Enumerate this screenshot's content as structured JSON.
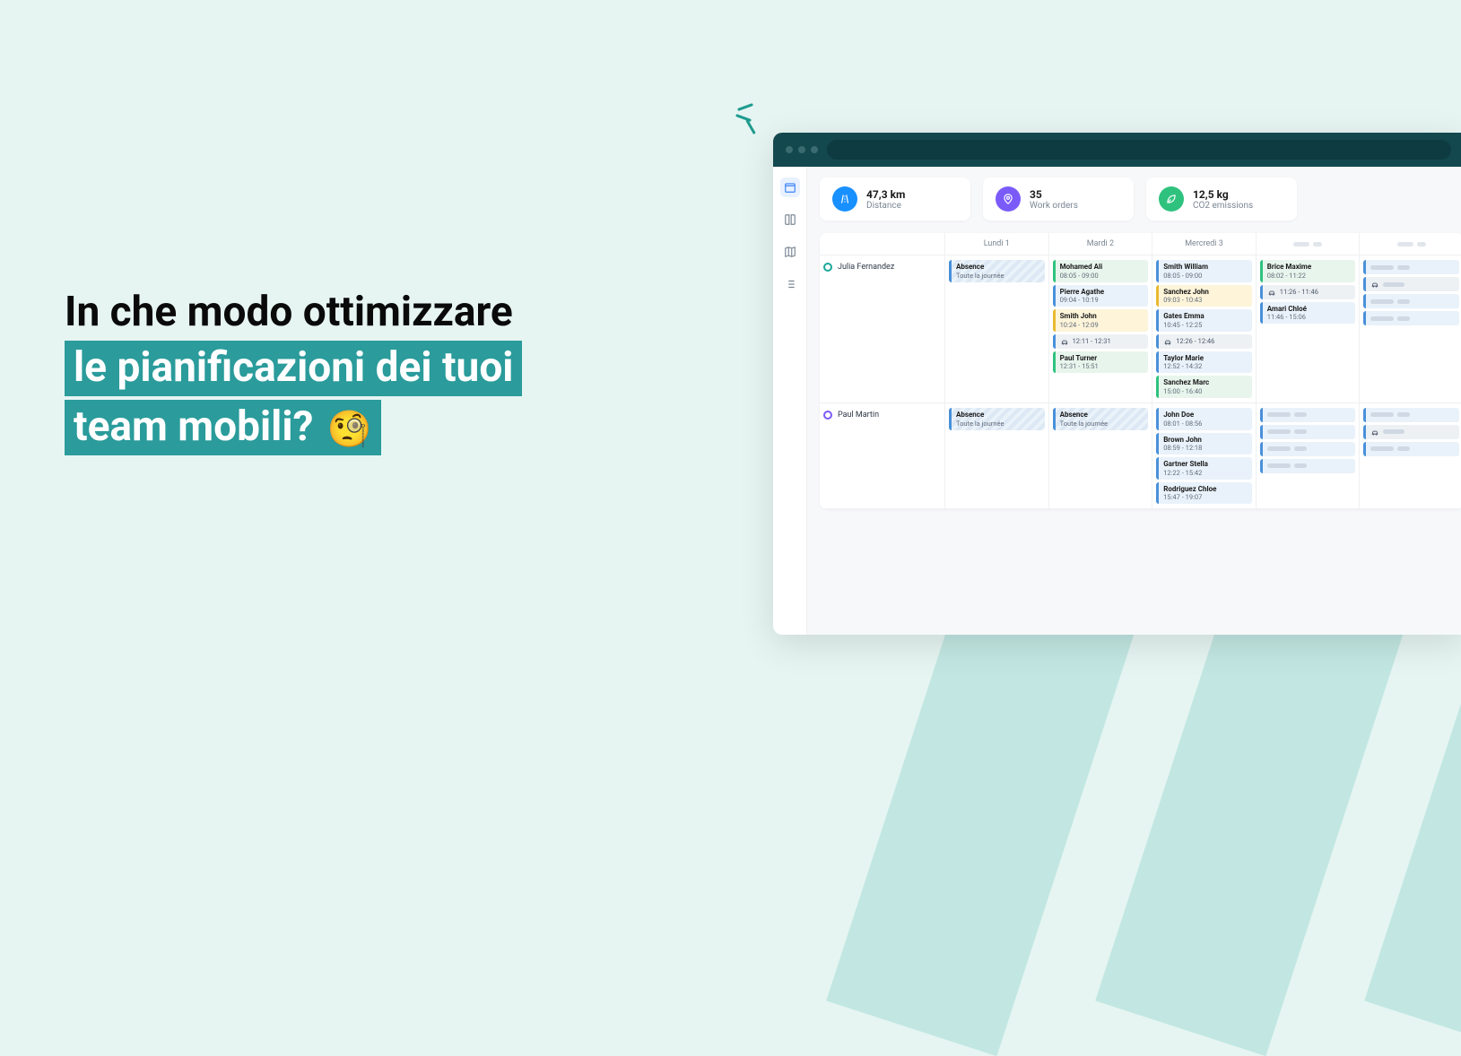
{
  "headline": {
    "line1": "In che modo ottimizzare",
    "line2": "le pianificazioni dei tuoi",
    "line3": "team mobili?",
    "emoji": "🧐"
  },
  "stats": [
    {
      "value": "47,3 km",
      "label": "Distance",
      "color": "blue",
      "icon": "road"
    },
    {
      "value": "35",
      "label": "Work orders",
      "color": "purple",
      "icon": "pin"
    },
    {
      "value": "12,5 kg",
      "label": "CO2 emissions",
      "color": "green",
      "icon": "leaf"
    }
  ],
  "days": [
    "Lundi 1",
    "Mardi 2",
    "Mercredi 3"
  ],
  "people": [
    {
      "name": "Julia Fernandez",
      "class": "julia",
      "cols": [
        [
          {
            "type": "absence",
            "name": "Absence",
            "time": "Toute la journée"
          }
        ],
        [
          {
            "type": "green",
            "name": "Mohamed Ali",
            "time": "08:05 - 09:00"
          },
          {
            "type": "blue",
            "name": "Pierre Agathe",
            "time": "09:04 - 10:19"
          },
          {
            "type": "yellow",
            "name": "Smith John",
            "time": "10:24 - 12:09"
          },
          {
            "type": "travel",
            "time": "12:11 - 12:31"
          },
          {
            "type": "green",
            "name": "Paul Turner",
            "time": "12:31 - 15:51"
          }
        ],
        [
          {
            "type": "blue",
            "name": "Smith William",
            "time": "08:05 - 09:00"
          },
          {
            "type": "yellow",
            "name": "Sanchez John",
            "time": "09:03 - 10:43"
          },
          {
            "type": "blue",
            "name": "Gates Emma",
            "time": "10:45 - 12:25"
          },
          {
            "type": "travel",
            "time": "12:26 - 12:46"
          },
          {
            "type": "blue",
            "name": "Taylor Marie",
            "time": "12:52 - 14:32"
          },
          {
            "type": "green",
            "name": "Sanchez Marc",
            "time": "15:00 - 16:40"
          }
        ],
        [
          {
            "type": "green",
            "name": "Brice Maxime",
            "time": "08:02 - 11:22"
          },
          {
            "type": "travel",
            "time": "11:26 - 11:46"
          },
          {
            "type": "blue",
            "name": "Amari Chloé",
            "time": "11:46 - 15:06"
          }
        ],
        [
          {
            "type": "placeholder"
          },
          {
            "type": "travel-placeholder"
          },
          {
            "type": "placeholder"
          },
          {
            "type": "placeholder"
          }
        ]
      ]
    },
    {
      "name": "Paul Martin",
      "class": "paul",
      "cols": [
        [
          {
            "type": "absence",
            "name": "Absence",
            "time": "Toute la journée"
          }
        ],
        [
          {
            "type": "absence",
            "name": "Absence",
            "time": "Toute la journée"
          }
        ],
        [
          {
            "type": "blue",
            "name": "John Doe",
            "time": "08:01 - 08:56"
          },
          {
            "type": "blue",
            "name": "Brown John",
            "time": "08:59 - 12:18"
          },
          {
            "type": "blue",
            "name": "Gartner Stella",
            "time": "12:22 - 15:42"
          },
          {
            "type": "blue",
            "name": "Rodriguez Chloe",
            "time": "15:47 - 19:07"
          }
        ],
        [
          {
            "type": "placeholder"
          },
          {
            "type": "placeholder"
          },
          {
            "type": "placeholder"
          },
          {
            "type": "placeholder"
          }
        ],
        [
          {
            "type": "placeholder"
          },
          {
            "type": "travel-placeholder"
          },
          {
            "type": "placeholder"
          }
        ]
      ]
    }
  ]
}
